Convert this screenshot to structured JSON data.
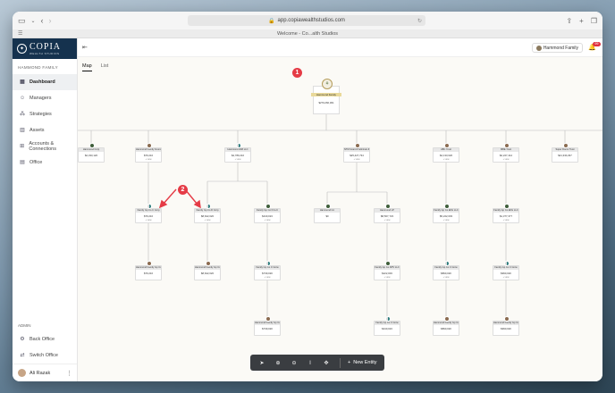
{
  "browser": {
    "url": "app.copiawealthstudios.com",
    "tab_title": "Welcome - Co...alth Studios"
  },
  "brand": {
    "name": "COPIA",
    "sub": "WEALTH STUDIOS"
  },
  "sidebar": {
    "family_label": "HAMMOND FAMILY",
    "items": [
      {
        "label": "Dashboard",
        "icon": "grid-icon"
      },
      {
        "label": "Managers",
        "icon": "people-icon"
      },
      {
        "label": "Strategies",
        "icon": "strategy-icon"
      },
      {
        "label": "Assets",
        "icon": "bar-chart-icon"
      },
      {
        "label": "Accounts & Connections",
        "icon": "accounts-icon"
      },
      {
        "label": "Office",
        "icon": "briefcase-icon"
      }
    ],
    "admin_label": "ADMIN",
    "admin_items": [
      {
        "label": "Back Office"
      },
      {
        "label": "Switch Office"
      }
    ],
    "user": "Ali Razak"
  },
  "topbar": {
    "family_selector": "Hammond Family",
    "notif_count": "99"
  },
  "view_tabs": [
    "Map",
    "List"
  ],
  "root": {
    "name": "Hammond Family",
    "value": "$279,260,361"
  },
  "nodes": [
    {
      "name": "Hammond Corp",
      "value": "$2,333,120"
    },
    {
      "name": "Hammond Family Founda",
      "value": "$79,210"
    },
    {
      "name": "Hammond IDM LLC",
      "value": "$4,789,210"
    },
    {
      "name": "NTM Grand Preliminar &",
      "value": "$25,427,734"
    },
    {
      "name": "ABC Trust",
      "value": "$4,133,026"
    },
    {
      "name": "MBE Trust",
      "value": "$2,227,412"
    },
    {
      "name": "Super Dorris Trust",
      "value": "$21,330,297"
    },
    {
      "name": "Family Gp Co C Corp",
      "value": "$79,210"
    },
    {
      "name": "Family Gp Co D Corp",
      "value": "$8,622,020"
    },
    {
      "name": "Family Gp Co D LLC",
      "value": "$440,023"
    },
    {
      "name": "Hammond Inc",
      "value": "$0"
    },
    {
      "name": "Hammond LP",
      "value": "$8,507,723"
    },
    {
      "name": "Family Gp Co EFG LLC",
      "value": "$5,222,003"
    },
    {
      "name": "Family Gp Co EFG LLC",
      "value": "$1,377,377"
    },
    {
      "name": "Hammond Family Gp Co",
      "value": "$79,210"
    },
    {
      "name": "Hammond Family Gp Co",
      "value": "$8,622,020"
    },
    {
      "name": "Family Gp Co C Grow",
      "value": "$739,020"
    },
    {
      "name": "Family Gp Co DPV LLC",
      "value": "$222,003"
    },
    {
      "name": "Family Gp Co C Grow",
      "value": "$890,020"
    },
    {
      "name": "Family Gp Co C Grow",
      "value": "$990,020"
    },
    {
      "name": "Hammond Family Gp Co",
      "value": "$739,020"
    },
    {
      "name": "Family Gp Co C Grow",
      "value": "$440,023"
    },
    {
      "name": "Hammond Family Gp Co",
      "value": "$890,020"
    },
    {
      "name": "Hammond Family Gp Co",
      "value": "$990,020"
    }
  ],
  "callouts": [
    "1",
    "2"
  ],
  "toolbar": {
    "new_entity": "New Entity"
  },
  "view_more": "+ view"
}
